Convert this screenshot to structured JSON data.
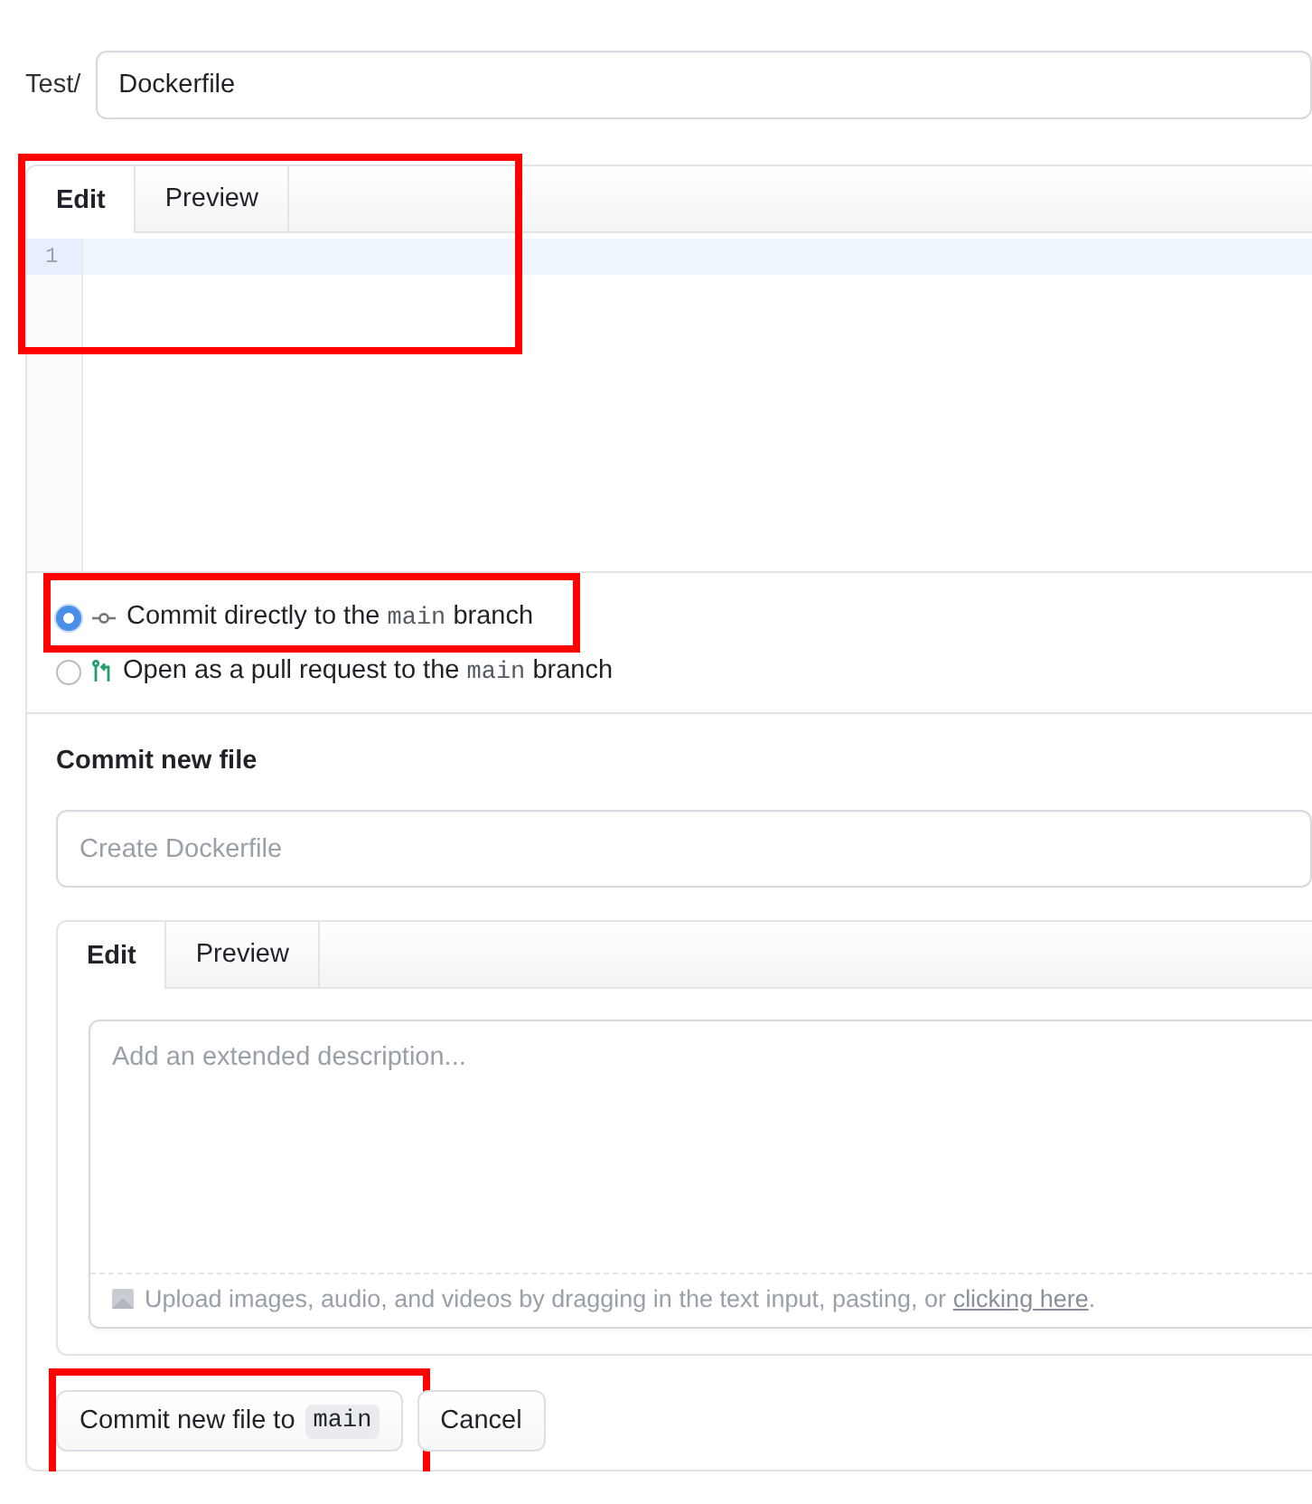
{
  "path": {
    "prefix": "Test/",
    "filename": "Dockerfile"
  },
  "editor": {
    "highlighted": true,
    "tabs": [
      {
        "label": "Edit",
        "selected": true
      },
      {
        "label": "Preview",
        "selected": false
      }
    ],
    "line_numbers": [
      "1"
    ]
  },
  "commit_options": [
    {
      "kind": "direct",
      "selected": true,
      "highlighted": true,
      "text_before": "Commit directly to the",
      "branch": "main",
      "text_after": "branch"
    },
    {
      "kind": "pull_request",
      "selected": false,
      "highlighted": false,
      "text_before": "Open as a pull request to the",
      "branch": "main",
      "text_after": "branch"
    }
  ],
  "commit_form": {
    "heading": "Commit new file",
    "summary": {
      "placeholder": "Create Dockerfile"
    },
    "tabs": [
      {
        "label": "Edit",
        "selected": true
      },
      {
        "label": "Preview",
        "selected": false
      }
    ],
    "description": {
      "placeholder": "Add an extended description..."
    },
    "upload_hint": {
      "text": "Upload images, audio, and videos by dragging in the text input, pasting, or",
      "link": "clicking here",
      "end": "."
    }
  },
  "buttons": [
    {
      "label": "Commit new file to",
      "branch": "main",
      "highlighted": true
    },
    {
      "label": "Cancel",
      "highlighted": false
    }
  ]
}
